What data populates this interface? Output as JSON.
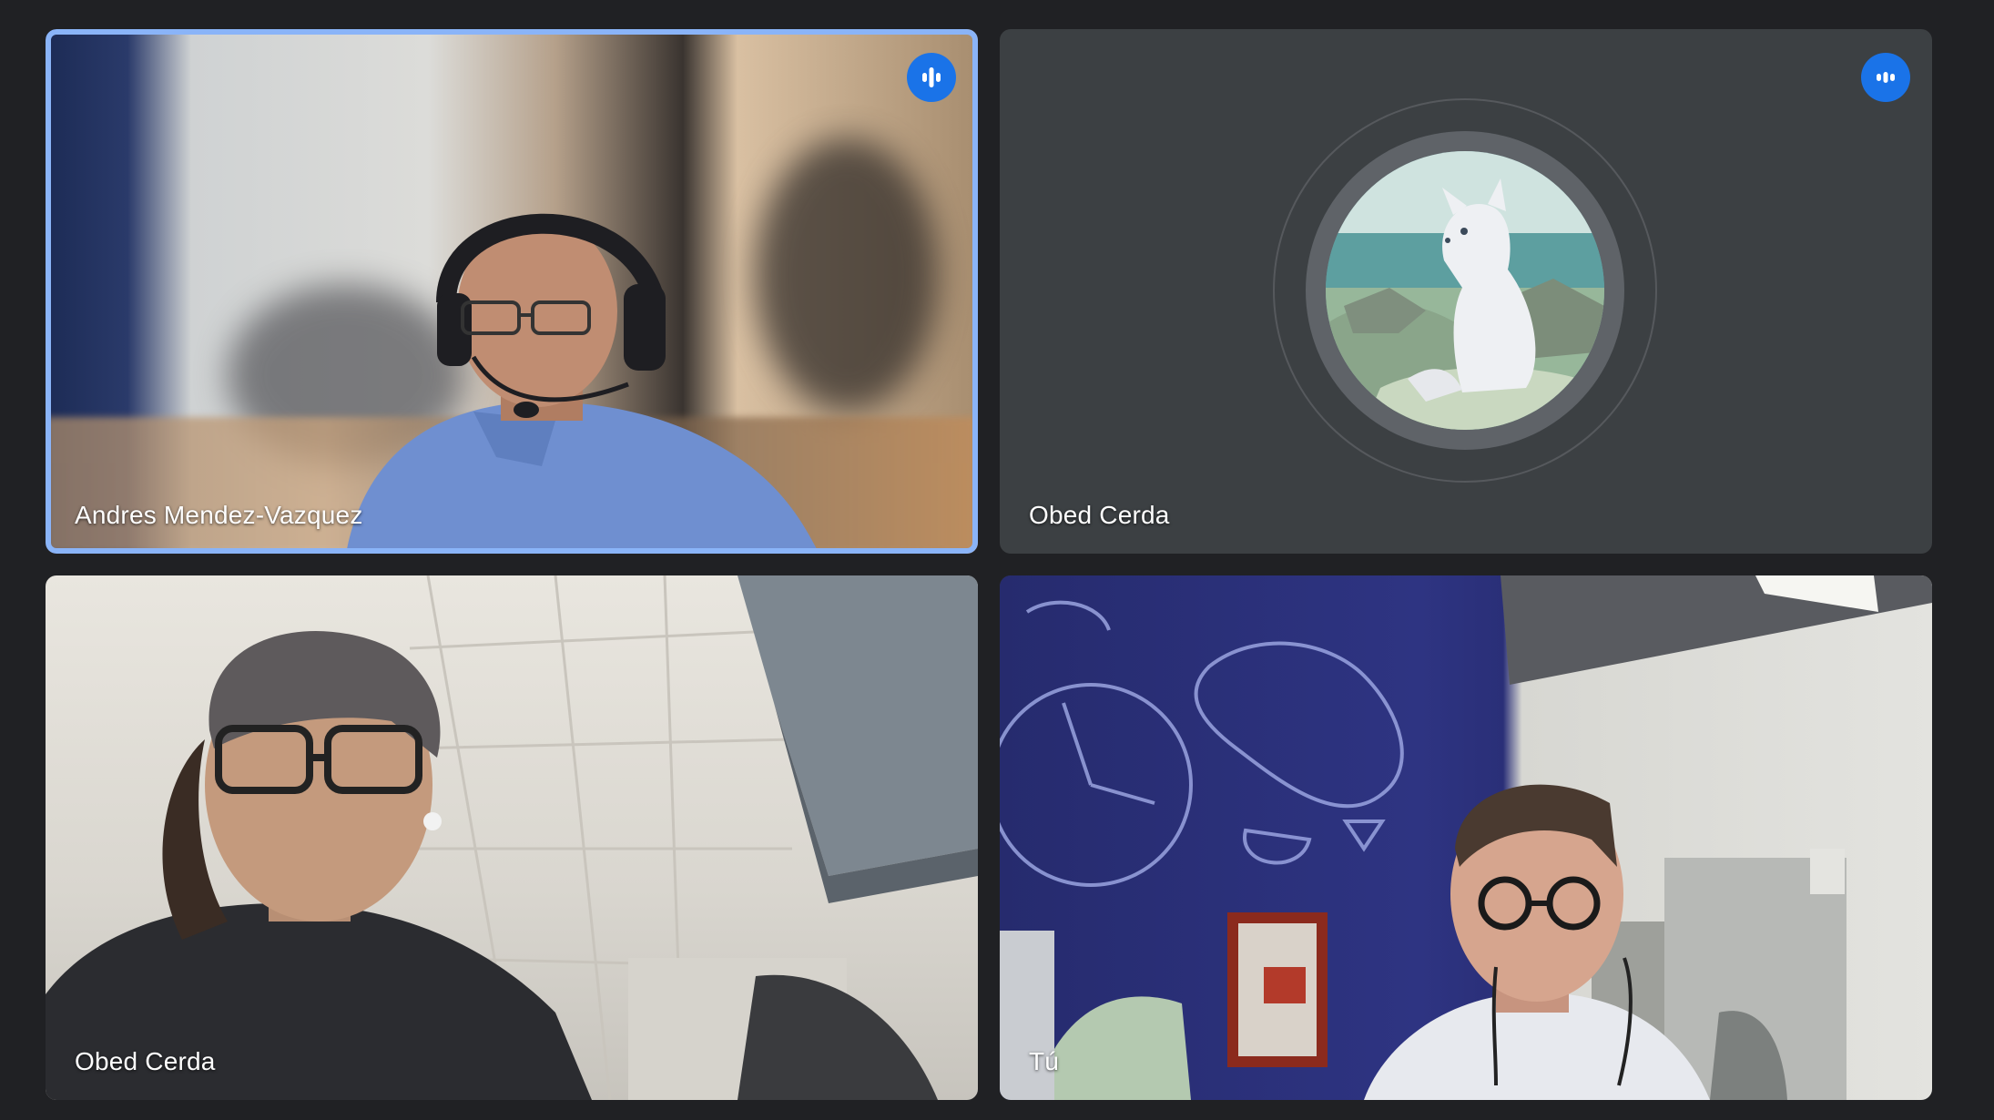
{
  "meeting": {
    "participants": [
      {
        "name": "Andres Mendez-Vazquez",
        "speaking": true,
        "video": true
      },
      {
        "name": "Obed Cerda",
        "speaking": true,
        "video": false,
        "avatar_icon": "arctic-fox-avatar-icon"
      },
      {
        "name": "Obed Cerda",
        "speaking": false,
        "video": true
      },
      {
        "name": "Tú",
        "speaking": false,
        "video": true
      }
    ]
  },
  "colors": {
    "background": "#202124",
    "tile": "#3c4043",
    "speaking_ring": "#8ab4f8",
    "indicator": "#1a73e8"
  }
}
